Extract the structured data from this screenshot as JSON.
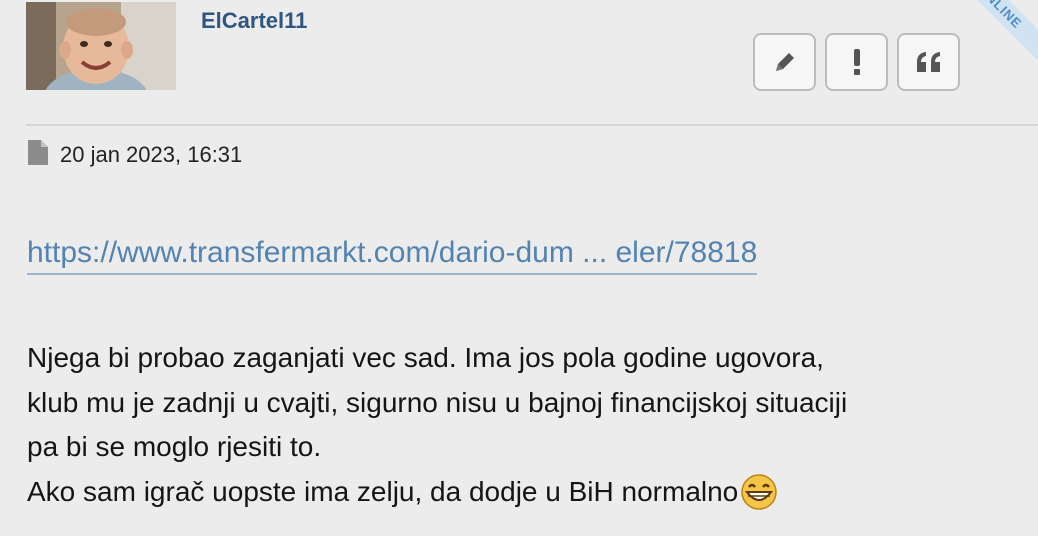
{
  "post": {
    "author": "ElCartel11",
    "online_badge": "ONLINE",
    "date": "20 jan 2023, 16:31",
    "link_text": "https://www.transfermarkt.com/dario-dum ... eler/78818",
    "body_lines": [
      "Njega bi probao zaganjati vec sad. Ima jos pola godine ugovora,",
      "klub mu je zadnji u cvajti, sigurno nisu u bajnoj financijskoj situaciji",
      "pa bi se moglo rjesiti to.",
      "Ako sam igrač uopste ima zelju, da dodje u BiH normalno"
    ]
  },
  "actions": [
    {
      "icon": "pencil-icon"
    },
    {
      "icon": "exclamation-icon"
    },
    {
      "icon": "quote-icon"
    }
  ],
  "icons": {
    "meta": "file-icon",
    "emoji": "grinning-face-emoji"
  },
  "colors": {
    "background": "#ececec",
    "username": "#2e5680",
    "link": "#5383b0",
    "text": "#151515",
    "online_ribbon": "#cfe3f3"
  }
}
